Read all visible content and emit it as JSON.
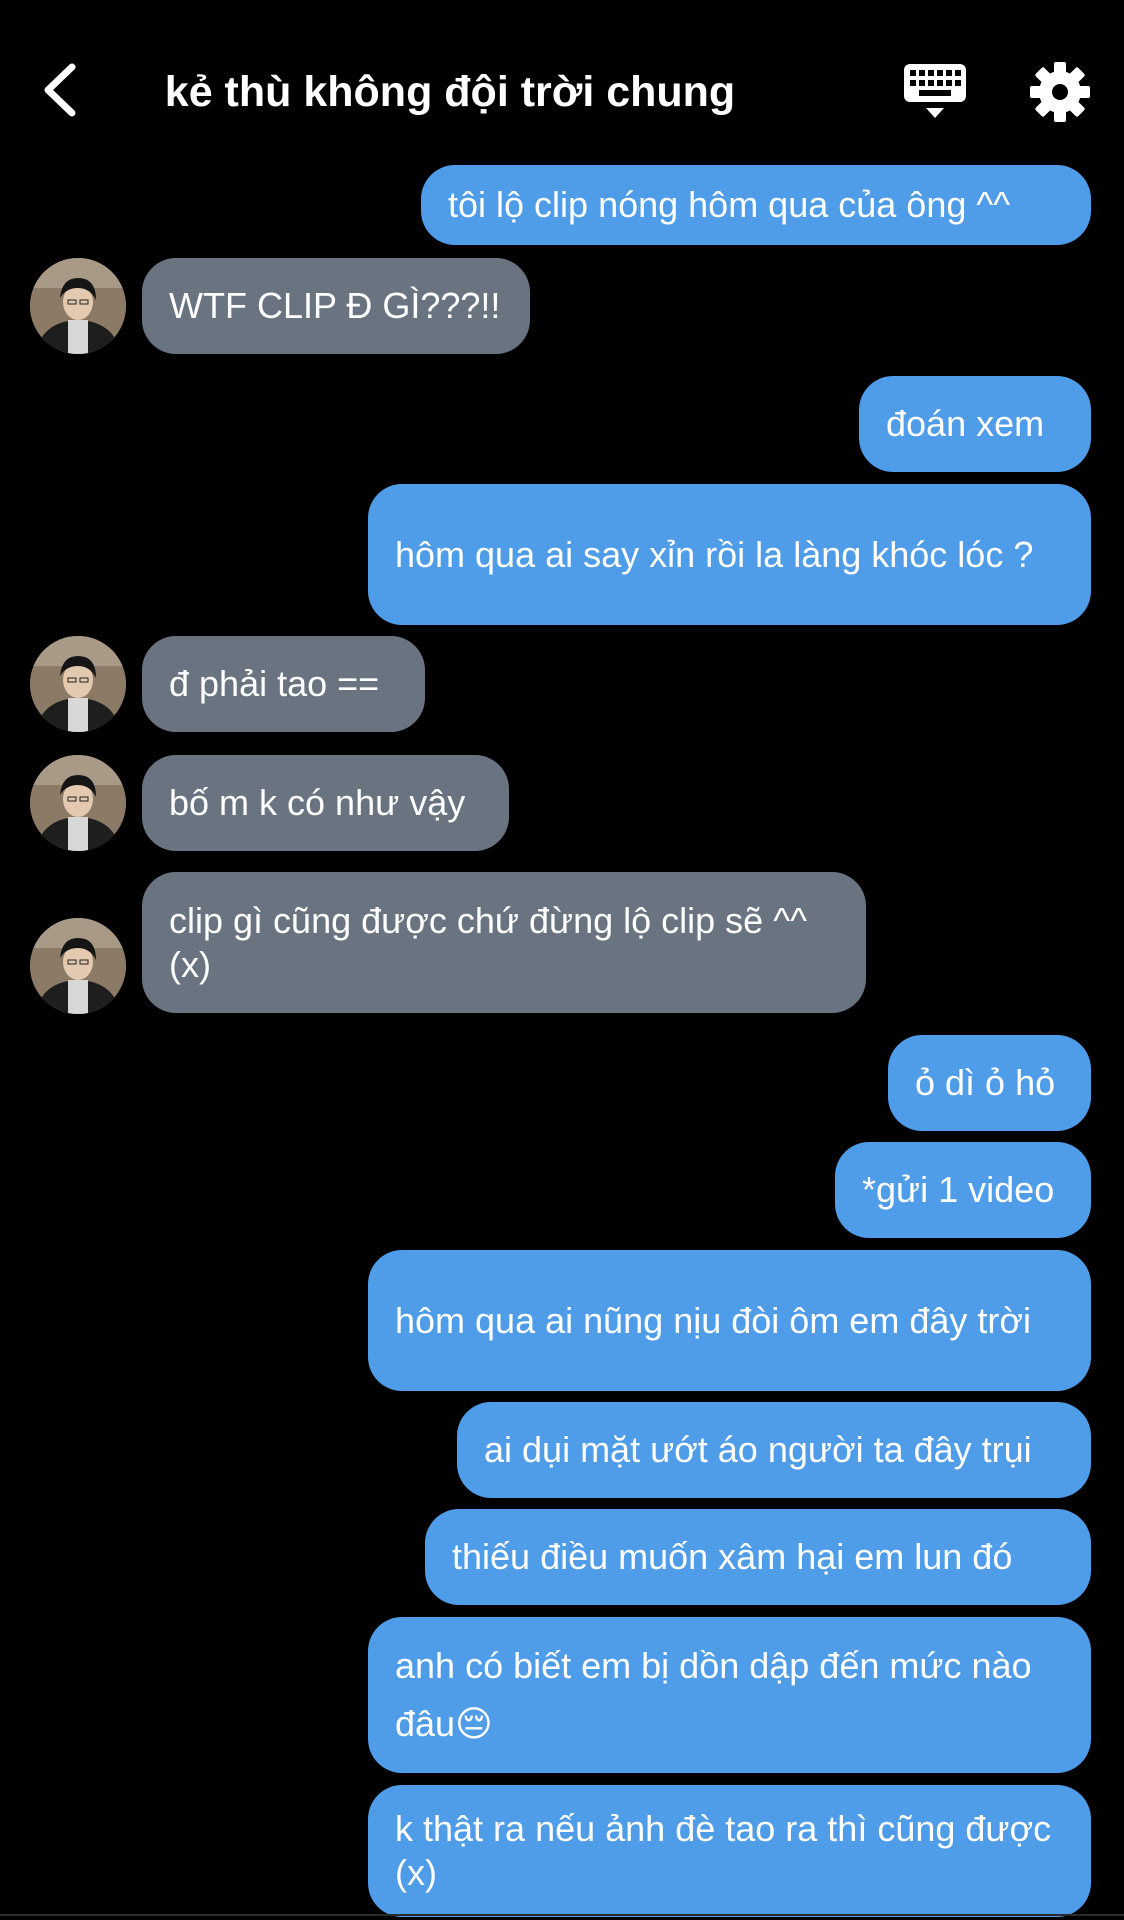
{
  "header": {
    "title": "kẻ thù không đội trời chung"
  },
  "icons": {
    "back": "chevron-left-icon",
    "keyboard": "keyboard-icon",
    "settings": "gear-icon"
  },
  "colors": {
    "outgoing_bubble": "#4f9ce8",
    "incoming_bubble": "#6a7481",
    "background": "#000000"
  },
  "messages": [
    {
      "sender": "me",
      "text": "tôi lộ clip nóng hôm qua của ông ^^"
    },
    {
      "sender": "them",
      "text": "WTF CLIP Đ GÌ???!!"
    },
    {
      "sender": "me",
      "text": "đoán xem"
    },
    {
      "sender": "me",
      "text": "hôm qua ai say xỉn rồi la làng khóc lóc ?"
    },
    {
      "sender": "them",
      "text": "đ phải tao =="
    },
    {
      "sender": "them",
      "text": "bố m k có như vậy"
    },
    {
      "sender": "them",
      "text": "clip gì cũng được chứ đừng lộ clip sẽ ^^ (x)"
    },
    {
      "sender": "me",
      "text": "ỏ dì ỏ hỏ"
    },
    {
      "sender": "me",
      "text": "*gửi 1 video"
    },
    {
      "sender": "me",
      "text": "hôm qua ai nũng nịu đòi ôm em đây trời"
    },
    {
      "sender": "me",
      "text": "ai dụi mặt ướt áo người ta đây trụi"
    },
    {
      "sender": "me",
      "text": "thiếu điều muốn xâm hại em lun đó"
    },
    {
      "sender": "me",
      "text": "anh có biết em bị dồn dập đến mức nào đâu😔"
    },
    {
      "sender": "me",
      "text": "k thật ra nếu ảnh đè tao ra thì cũng được (x)"
    }
  ]
}
